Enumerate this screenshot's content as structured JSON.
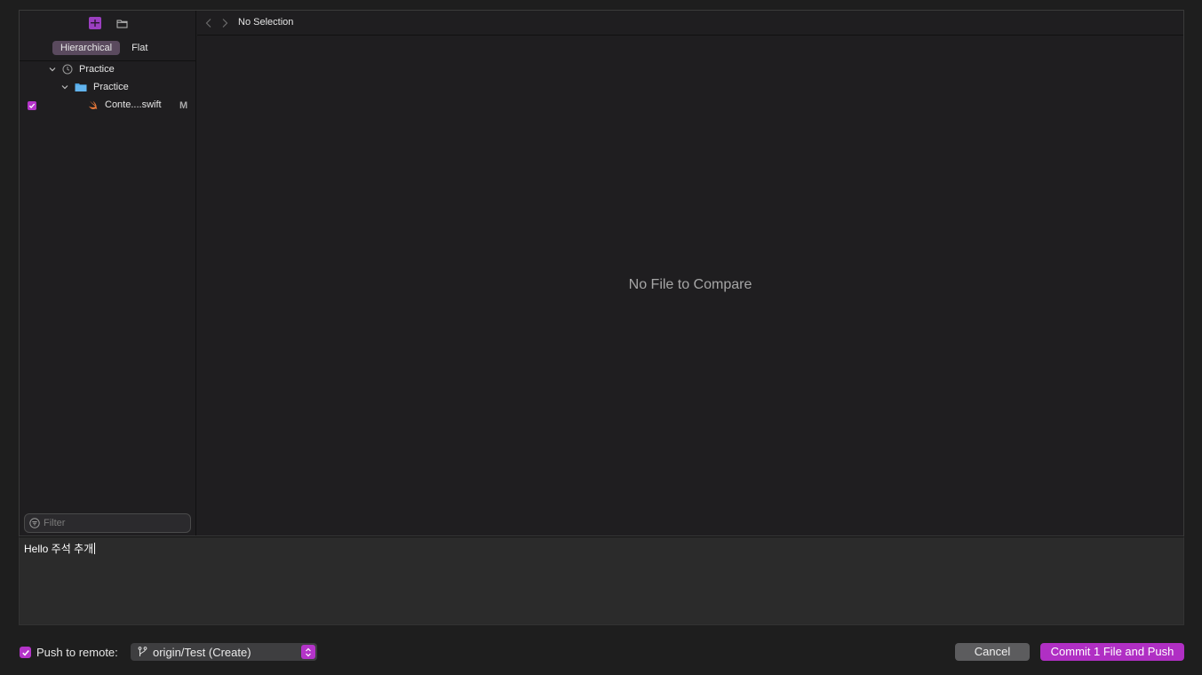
{
  "sidebar": {
    "toolbar": {
      "changes_icon": "changes-icon",
      "folder_icon": "folder-icon"
    },
    "view_mode": {
      "hierarchical": "Hierarchical",
      "flat": "Flat",
      "selected": "Hierarchical"
    },
    "tree": [
      {
        "label": "Practice",
        "icon": "clock-icon",
        "level": 0
      },
      {
        "label": "Practice",
        "icon": "folder-icon",
        "level": 1
      },
      {
        "label": "Conte....swift",
        "icon": "swift-icon",
        "level": 2,
        "checked": true,
        "status": "M"
      }
    ],
    "filter_placeholder": "Filter"
  },
  "content": {
    "breadcrumb": "No Selection",
    "empty_message": "No File to Compare"
  },
  "commit_message": "Hello 주석 추개",
  "footer": {
    "push_checked": true,
    "push_label": "Push to remote:",
    "branch": "origin/Test (Create)",
    "cancel_label": "Cancel",
    "commit_label": "Commit 1 File and Push"
  },
  "colors": {
    "accent": "#b434c9",
    "background": "#1e1e1e",
    "panel": "#2b2b2b"
  }
}
